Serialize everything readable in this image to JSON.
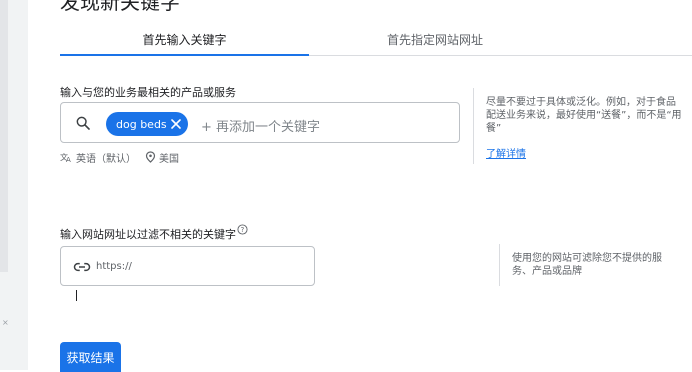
{
  "page": {
    "title": "发现新关键字"
  },
  "tabs": [
    {
      "label": "首先输入关键字",
      "active": true
    },
    {
      "label": "首先指定网站网址",
      "active": false
    }
  ],
  "keywords_section": {
    "label": "输入与您的业务最相关的产品或服务",
    "chips": [
      {
        "label": "dog beds"
      }
    ],
    "add_placeholder": "+ 再添加一个关键字",
    "language": "英语（默认）",
    "location": "美国"
  },
  "keywords_hint": {
    "line1": "尽量不要过于具体或泛化。例如，对于食品",
    "line2": "配送业务来说，最好使用“送餐”，而不是“用",
    "line3": "餐”",
    "link": "了解详情"
  },
  "url_section": {
    "label": "输入网站网址以过滤不相关的关键字",
    "placeholder": "https://"
  },
  "url_hint": {
    "line1": "使用您的网站可滤除您不提供的服",
    "line2": "务、产品或品牌"
  },
  "submit": {
    "label": "获取结果"
  },
  "colors": {
    "accent": "#1a73e8",
    "border": "#bdc1c6",
    "muted_text": "#5f6368"
  },
  "icons": {
    "search": "search-icon",
    "chip_remove": "close-icon",
    "language": "translate-icon",
    "location": "location-pin-icon",
    "url": "link-icon",
    "help": "help-circle-icon"
  }
}
